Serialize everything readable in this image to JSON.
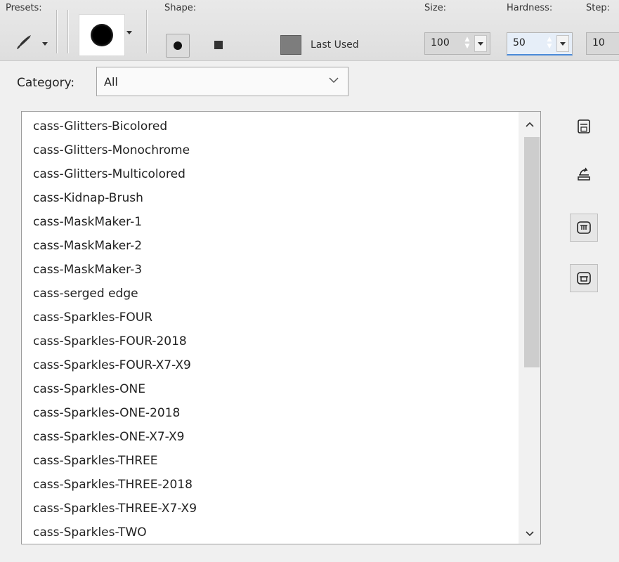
{
  "toolbar": {
    "presets_label": "Presets:",
    "shape_label": "Shape:",
    "last_used_label": "Last Used",
    "size_label": "Size:",
    "size_value": "100",
    "hardness_label": "Hardness:",
    "hardness_value": "50",
    "step_label": "Step:",
    "step_value": "10",
    "selected_shape": "round",
    "icons": {
      "preset": "brush-icon",
      "shape_round": "round-shape-icon",
      "shape_square": "square-shape-icon"
    }
  },
  "category": {
    "label": "Category:",
    "value": "All"
  },
  "brush_list": {
    "items": [
      "cass-Glitters-Bicolored",
      "cass-Glitters-Monochrome",
      "cass-Glitters-Multicolored",
      "cass-Kidnap-Brush",
      "cass-MaskMaker-1",
      "cass-MaskMaker-2",
      "cass-MaskMaker-3",
      "cass-serged edge",
      "cass-Sparkles-FOUR",
      "cass-Sparkles-FOUR-2018",
      "cass-Sparkles-FOUR-X7-X9",
      "cass-Sparkles-ONE",
      "cass-Sparkles-ONE-2018",
      "cass-Sparkles-ONE-X7-X9",
      "cass-Sparkles-THREE",
      "cass-Sparkles-THREE-2018",
      "cass-Sparkles-THREE-X7-X9",
      "cass-Sparkles-TWO"
    ]
  },
  "side_icons": [
    "save-icon",
    "import-icon",
    "category-icon",
    "export-icon"
  ],
  "colors": {
    "toolbar_bg": "#e3e3e3",
    "panel_bg": "#f0f0f0",
    "list_bg": "#ffffff",
    "focus_accent": "#4a8ad8"
  }
}
